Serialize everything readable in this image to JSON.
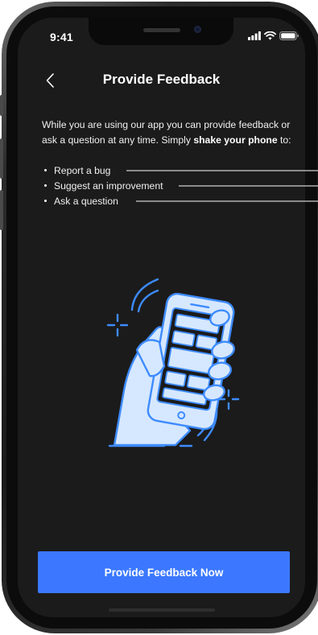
{
  "status_bar": {
    "time": "9:41",
    "signal_icon": "cellular-signal-icon",
    "wifi_icon": "wifi-icon",
    "battery_icon": "battery-icon"
  },
  "nav": {
    "back_icon": "chevron-left-icon",
    "title": "Provide Feedback"
  },
  "intro": {
    "text_before": "While you are using our app you can provide feedback or ask a question at any time. Simply ",
    "text_bold": "shake your phone",
    "text_after": " to:"
  },
  "options": [
    {
      "label": "Report a bug"
    },
    {
      "label": "Suggest an improvement"
    },
    {
      "label": "Ask a question"
    }
  ],
  "illustration": {
    "icon": "hand-shaking-phone-icon"
  },
  "cta": {
    "label": "Provide Feedback Now"
  },
  "colors": {
    "accent": "#3b78ff",
    "screen_background": "#1b1b1b",
    "illustration_fill": "#d6e8ff",
    "illustration_stroke": "#3d8bff"
  }
}
